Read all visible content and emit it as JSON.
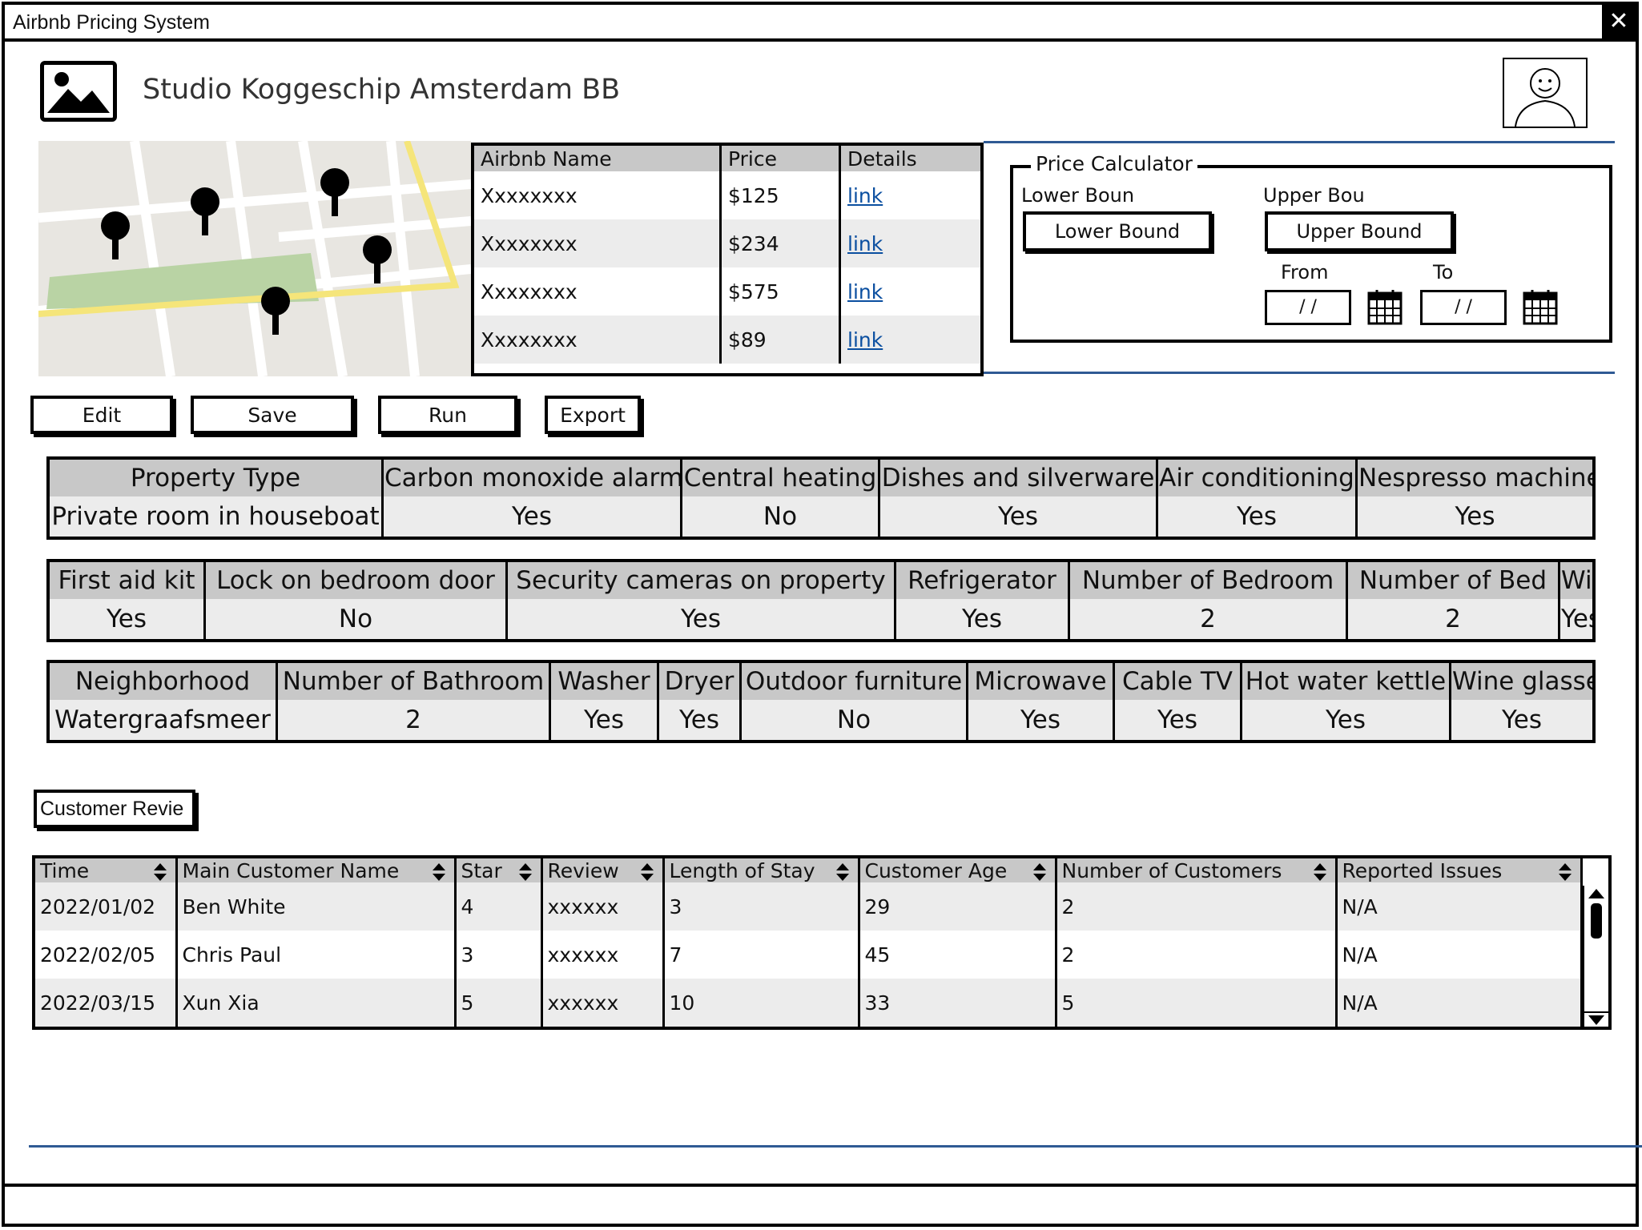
{
  "window": {
    "title": "Airbnb Pricing System",
    "close_label": "✕"
  },
  "header": {
    "title": "Studio Koggeschip Amsterdam BB"
  },
  "listing_table": {
    "columns": [
      "Airbnb Name",
      "Price",
      "Details"
    ],
    "rows": [
      {
        "name": "Xxxxxxxx",
        "price": "$125",
        "details": "link"
      },
      {
        "name": "Xxxxxxxx",
        "price": "$234",
        "details": "link"
      },
      {
        "name": "Xxxxxxxx",
        "price": "$575",
        "details": "link"
      },
      {
        "name": "Xxxxxxxx",
        "price": "$89",
        "details": "link"
      }
    ]
  },
  "price_calculator": {
    "legend": "Price Calculator",
    "lower_label": "Lower Boun",
    "upper_label": "Upper Bou",
    "lower_button": "Lower Bound",
    "upper_button": "Upper Bound",
    "from_label": "From",
    "to_label": "To",
    "from_value": "/ /",
    "to_value": "/ /"
  },
  "actions": {
    "edit": "Edit",
    "save": "Save",
    "run": "Run",
    "export": "Export"
  },
  "attributes_1": {
    "headers": [
      "Property Type",
      "Carbon monoxide alarm",
      "Central heating",
      "Dishes and silverware",
      "Air conditioning",
      "Nespresso machine"
    ],
    "values": [
      "Private room in houseboat",
      "Yes",
      "No",
      "Yes",
      "Yes",
      "Yes"
    ]
  },
  "attributes_2": {
    "headers": [
      "First aid kit",
      "Lock on bedroom door",
      "Security cameras on property",
      "Refrigerator",
      "Number of Bedroom",
      "Number of Bed",
      "Wifi"
    ],
    "values": [
      "Yes",
      "No",
      "Yes",
      "Yes",
      "2",
      "2",
      "Yes"
    ]
  },
  "attributes_3": {
    "headers": [
      "Neighborhood",
      "Number of Bathroom",
      "Washer",
      "Dryer",
      "Outdoor furniture",
      "Microwave",
      "Cable TV",
      "Hot water kettle",
      "Wine glasses"
    ],
    "values": [
      "Watergraafsmeer",
      "2",
      "Yes",
      "Yes",
      "No",
      "Yes",
      "Yes",
      "Yes",
      "Yes"
    ]
  },
  "reviews": {
    "button_label": "Customer Revie",
    "columns": [
      "Time",
      "Main Customer Name",
      "Star",
      "Review",
      "Length of Stay",
      "Customer Age",
      "Number of Customers",
      "Reported Issues"
    ],
    "rows": [
      [
        "2022/01/02",
        "Ben White",
        "4",
        "xxxxxx",
        "3",
        "29",
        "2",
        "N/A"
      ],
      [
        "2022/02/05",
        "Chris Paul",
        "3",
        "xxxxxx",
        "7",
        "45",
        "2",
        "N/A"
      ],
      [
        "2022/03/15",
        "Xun Xia",
        "5",
        "xxxxxx",
        "10",
        "33",
        "5",
        "N/A"
      ]
    ]
  }
}
